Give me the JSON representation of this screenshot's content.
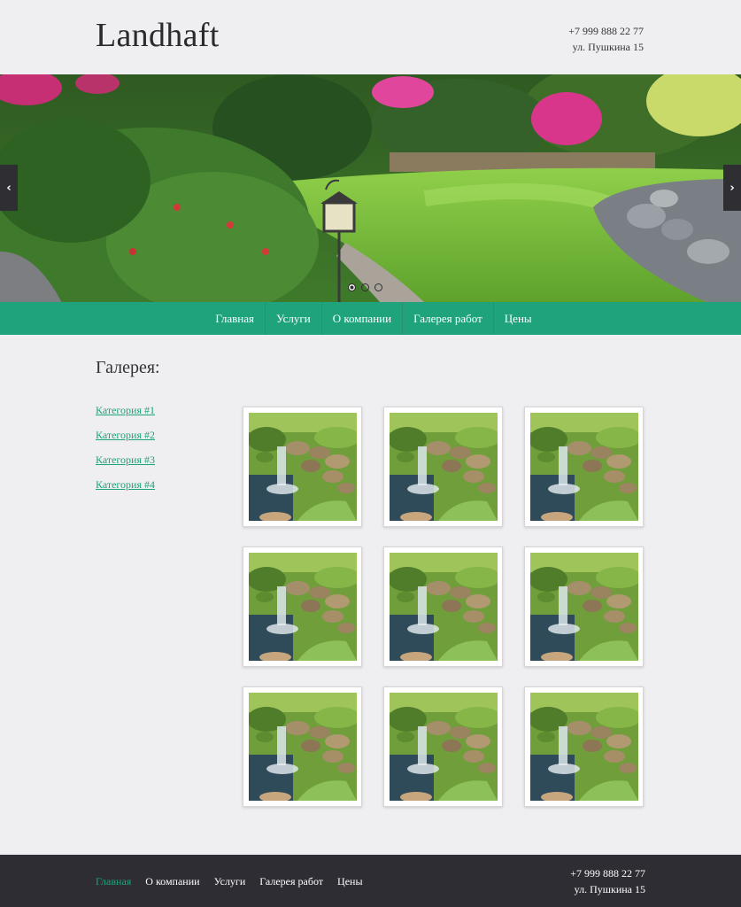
{
  "header": {
    "logo": "Landhaft",
    "phone": "+7 999 888 22 77",
    "address": "ул. Пушкина 15"
  },
  "slider": {
    "prev_icon": "chevron-left-icon",
    "next_icon": "chevron-right-icon",
    "prev_glyph": "‹",
    "next_glyph": "›",
    "slide_count": 3,
    "active_slide": 1
  },
  "nav": {
    "items": [
      {
        "label": "Главная"
      },
      {
        "label": "Услуги"
      },
      {
        "label": "О компании"
      },
      {
        "label": "Галерея работ"
      },
      {
        "label": "Цены"
      }
    ]
  },
  "main": {
    "title": "Галерея:",
    "categories": [
      {
        "label": "Категория #1"
      },
      {
        "label": "Категория #2"
      },
      {
        "label": "Категория #3"
      },
      {
        "label": "Категория #4"
      }
    ],
    "gallery_count": 9
  },
  "footer": {
    "nav": [
      {
        "label": "Главная",
        "active": true
      },
      {
        "label": "О компании",
        "active": false
      },
      {
        "label": "Услуги",
        "active": false
      },
      {
        "label": "Галерея работ",
        "active": false
      },
      {
        "label": "Цены",
        "active": false
      }
    ],
    "phone": "+7 999 888 22 77",
    "address": "ул. Пушкина 15"
  },
  "colors": {
    "accent": "#1fa37c",
    "footer_bg": "#2e2d33",
    "page_bg": "#efeef0"
  }
}
